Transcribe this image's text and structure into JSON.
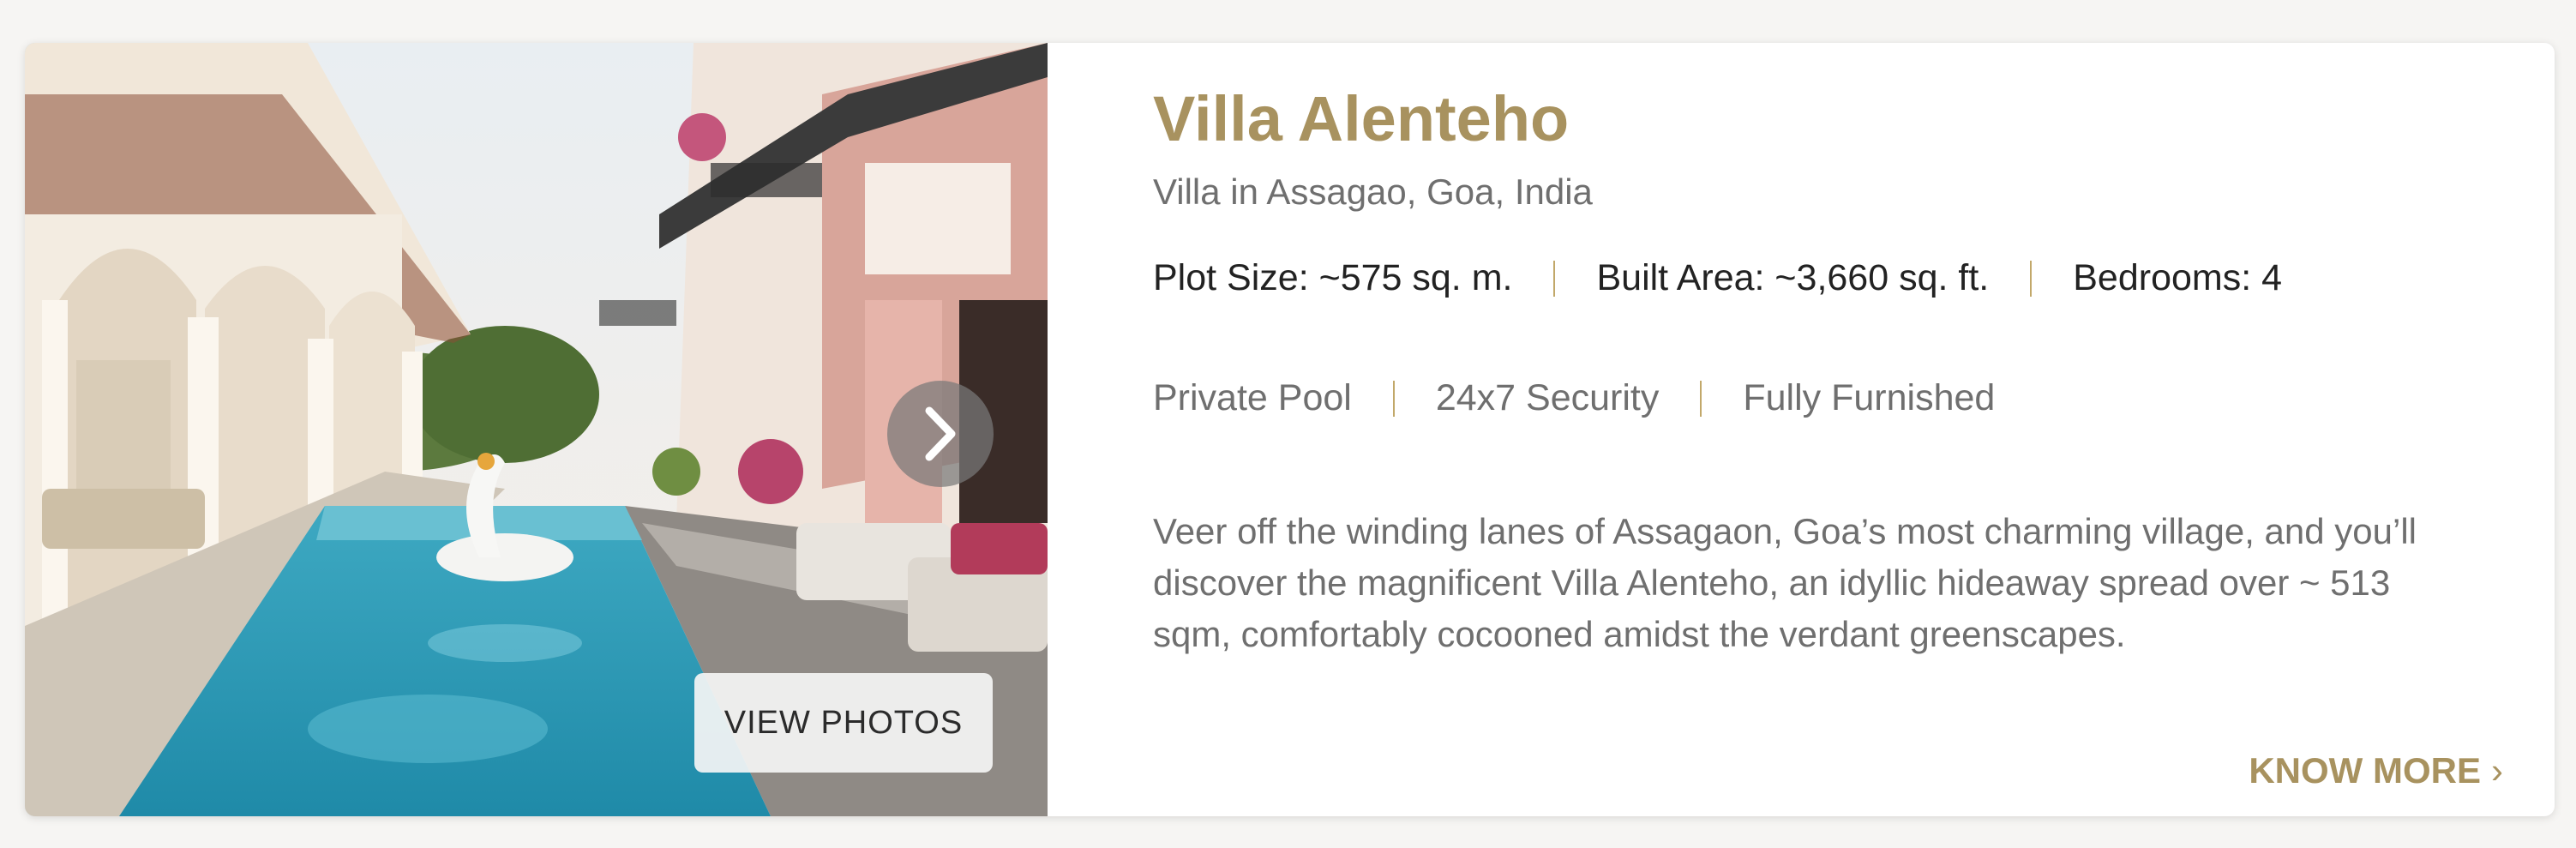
{
  "listing": {
    "title": "Villa Alenteho",
    "subtitle": "Villa in Assagao, Goa, India",
    "stats": [
      "Plot Size: ~575 sq. m.",
      "Built Area: ~3,660 sq. ft.",
      "Bedrooms: 4"
    ],
    "features": [
      "Private Pool",
      "24x7 Security",
      "Fully Furnished"
    ],
    "description": "Veer off the winding lanes of Assagaon, Goa’s most charming village, and you’ll discover the magnificent Villa Alenteho, an idyllic hideaway spread over ~ 513 sqm, comfortably cocooned amidst the verdant greenscapes.",
    "view_photos_label": "VIEW PHOTOS",
    "know_more_label": "KNOW MORE",
    "next_icon": "chevron-right-icon",
    "know_more_icon": "chevron-right-icon"
  },
  "colors": {
    "accent": "#a8925f",
    "separator": "#c2a86a",
    "text_dark": "#222222",
    "text_muted": "#6f6f6f"
  }
}
